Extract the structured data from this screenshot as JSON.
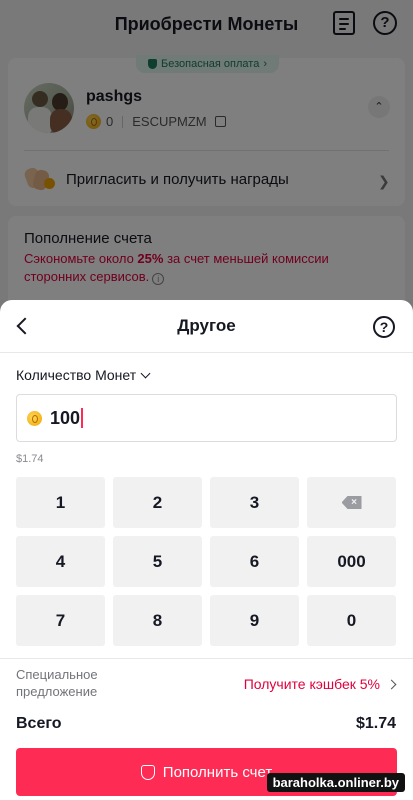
{
  "background": {
    "title": "Приобрести Монеты",
    "icons": {
      "history": "receipt-icon",
      "help": "help-circle-icon"
    },
    "secure_badge": "Безопасная оплата",
    "account": {
      "username": "pashgs",
      "coins": "0",
      "user_id": "ESCUPMZM"
    },
    "invite_label": "Пригласить и получить награды",
    "recharge": {
      "title": "Пополнение счета",
      "save_prefix": "Сэкономьте около ",
      "save_pct": "25%",
      "save_suffix": " за счет меньшей комиссии сторонних сервисов."
    }
  },
  "sheet": {
    "title": "Другое",
    "quantity_label": "Количество Монет",
    "input_value": "100",
    "usd_value": "$1.74",
    "keys": [
      "1",
      "2",
      "3",
      "",
      "4",
      "5",
      "6",
      "000",
      "7",
      "8",
      "9",
      "0"
    ],
    "offer_label": "Специальное предложение",
    "cashback": "Получите кэшбек 5%",
    "total_label": "Всего",
    "total_value": "$1.74",
    "pay_button": "Пополнить счет"
  },
  "watermark": "baraholka.onliner.by",
  "colors": {
    "accent": "#fe2c55",
    "promo": "#e0003c",
    "secure": "#1f7a5d"
  }
}
